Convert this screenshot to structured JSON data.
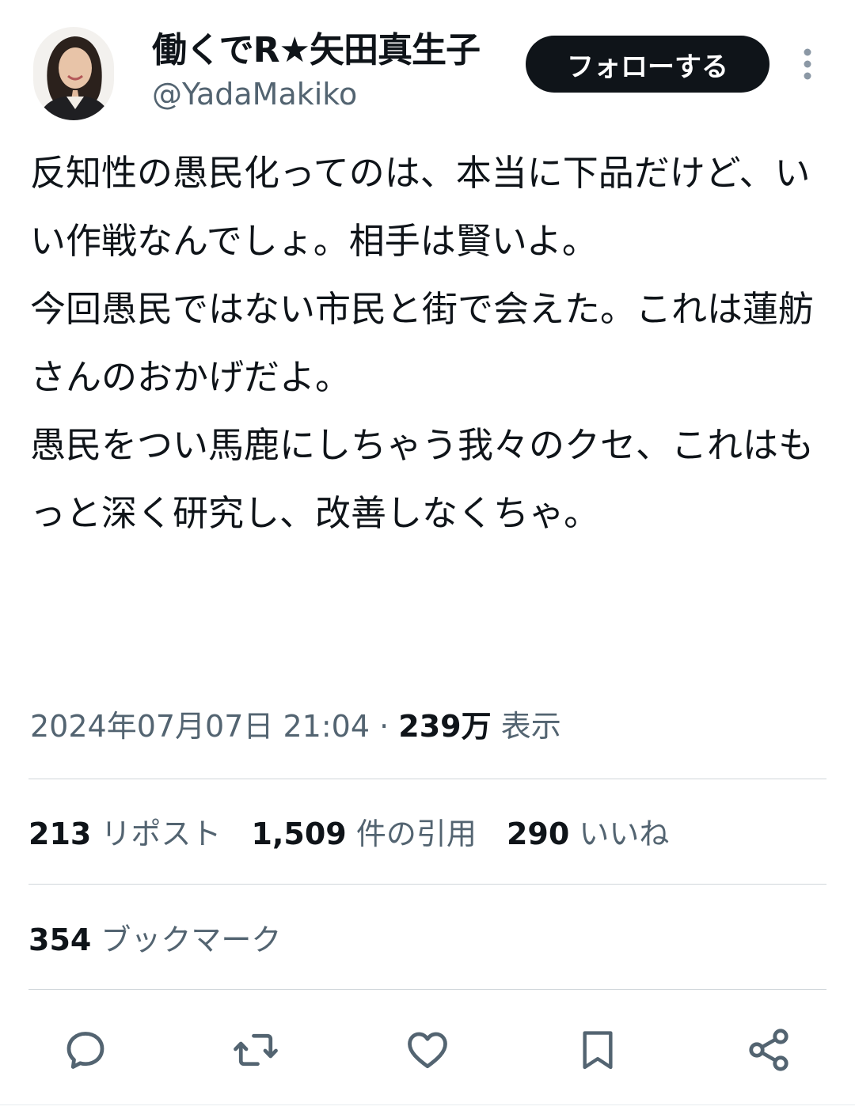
{
  "author": {
    "display_name": "働くでR★矢田真生子",
    "handle": "@YadaMakiko"
  },
  "follow_label": "フォローする",
  "tweet": {
    "text": "反知性の愚民化ってのは、本当に下品だけど、いい作戦なんでしょ。相手は賢いよ。\n今回愚民ではない市民と街で会えた。これは蓮舫さんのおかげだよ。\n愚民をつい馬鹿にしちゃう我々のクセ、これはもっと深く研究し、改善しなくちゃ。"
  },
  "meta": {
    "timestamp": "2024年07月07日 21:04",
    "separator": "·",
    "views_count": "239万",
    "views_label": "表示"
  },
  "stats": {
    "reposts": {
      "count": "213",
      "label": "リポスト"
    },
    "quotes": {
      "count": "1,509",
      "label": "件の引用"
    },
    "likes": {
      "count": "290",
      "label": "いいね"
    },
    "bookmarks": {
      "count": "354",
      "label": "ブックマーク"
    }
  },
  "icons": {
    "reply": "reply-icon",
    "repost": "repost-icon",
    "like": "heart-icon",
    "bookmark": "bookmark-icon",
    "share": "share-icon",
    "more": "more-vertical-icon"
  },
  "colors": {
    "text": "#0f1419",
    "secondary": "#536471",
    "button": "#0f1419"
  }
}
